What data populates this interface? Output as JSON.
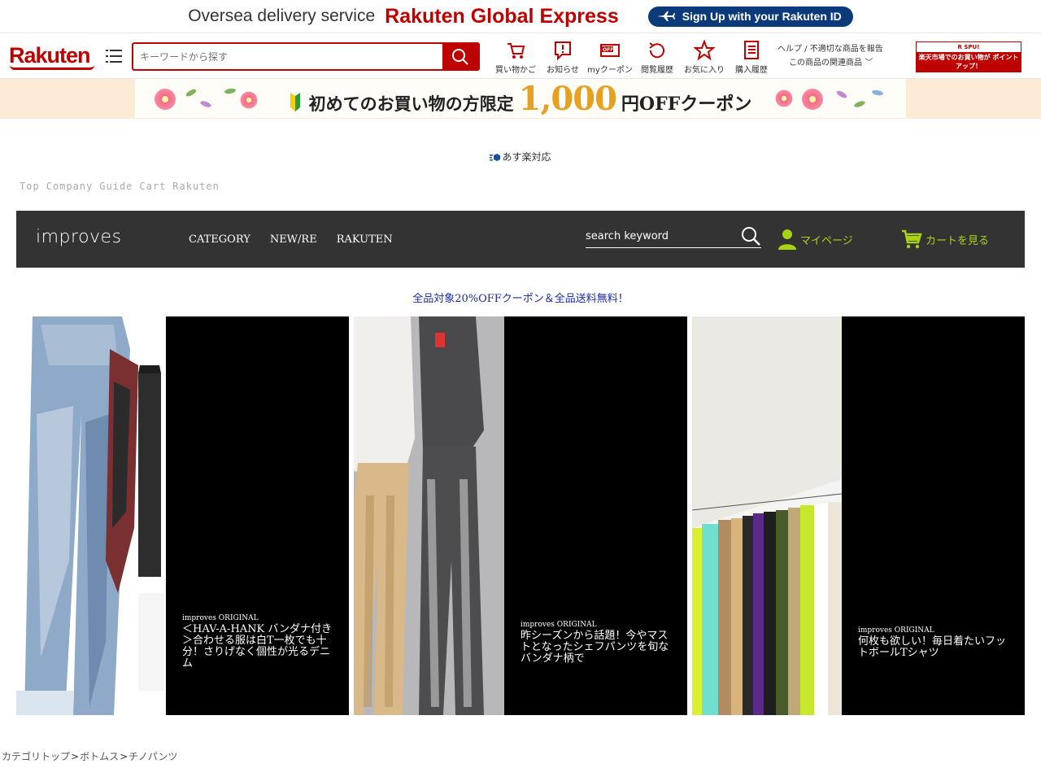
{
  "promo": {
    "oversea_text": "Oversea delivery service",
    "rge_text": "Rakuten Global Express",
    "signup_label": "Sign Up with your Rakuten ID"
  },
  "header": {
    "logo": "Rakuten",
    "search_placeholder": "キーワードから探す",
    "nav_items": [
      {
        "label": "買い物かご",
        "icon": "cart-icon"
      },
      {
        "label": "お知らせ",
        "icon": "notification-icon"
      },
      {
        "label": "myクーポン",
        "icon": "coupon-icon"
      },
      {
        "label": "閲覧履歴",
        "icon": "history-icon"
      },
      {
        "label": "お気に入り",
        "icon": "star-icon"
      },
      {
        "label": "購入履歴",
        "icon": "purchase-history-icon"
      }
    ],
    "help_link": "ヘルプ / 不適切な商品を報告",
    "related_link": "この商品の関連商品",
    "spu_top": "R SPU!",
    "spu_text": "楽天市場でのお買い物が ポイントアップ！"
  },
  "coupon_banner": {
    "text": "初めてのお買い物の方限定",
    "amount": "1,000",
    "suffix": "円OFFクーポン"
  },
  "asuraku_text": "あす楽対応",
  "text_nav": [
    "Top",
    "Company",
    "Guide",
    "Cart",
    "Rakuten"
  ],
  "store": {
    "logo": "improves",
    "nav": [
      "CATEGORY",
      "NEW/RE",
      "RAKUTEN"
    ],
    "search_value": "search keyword",
    "mypage_label": "マイページ",
    "cart_label": "カートを見る"
  },
  "sale_line": "全品対象20%OFFクーポン＆全品送料無料！",
  "features": [
    {
      "brand": "improves ORIGINAL",
      "title": "＜HAV-A-HANK バンダナ付き＞合わせる服は白T一枚でも十分！さりげなく個性が光るデニム"
    },
    {
      "brand": "improves ORIGINAL",
      "title": "昨シーズンから話題！今やマストとなったシェフパンツを旬なバンダナ柄で"
    },
    {
      "brand": "improves ORIGINAL",
      "title": "何枚も欲しい！毎日着たいフットボールTシャツ"
    }
  ],
  "breadcrumb": [
    "カテゴリトップ",
    "ボトムス",
    "チノパンツ"
  ],
  "colors": {
    "rakuten_red": "#bf0000",
    "store_bar": "#333333",
    "accent_green": "#a8d414",
    "sale_blue": "#1a2aa8"
  }
}
